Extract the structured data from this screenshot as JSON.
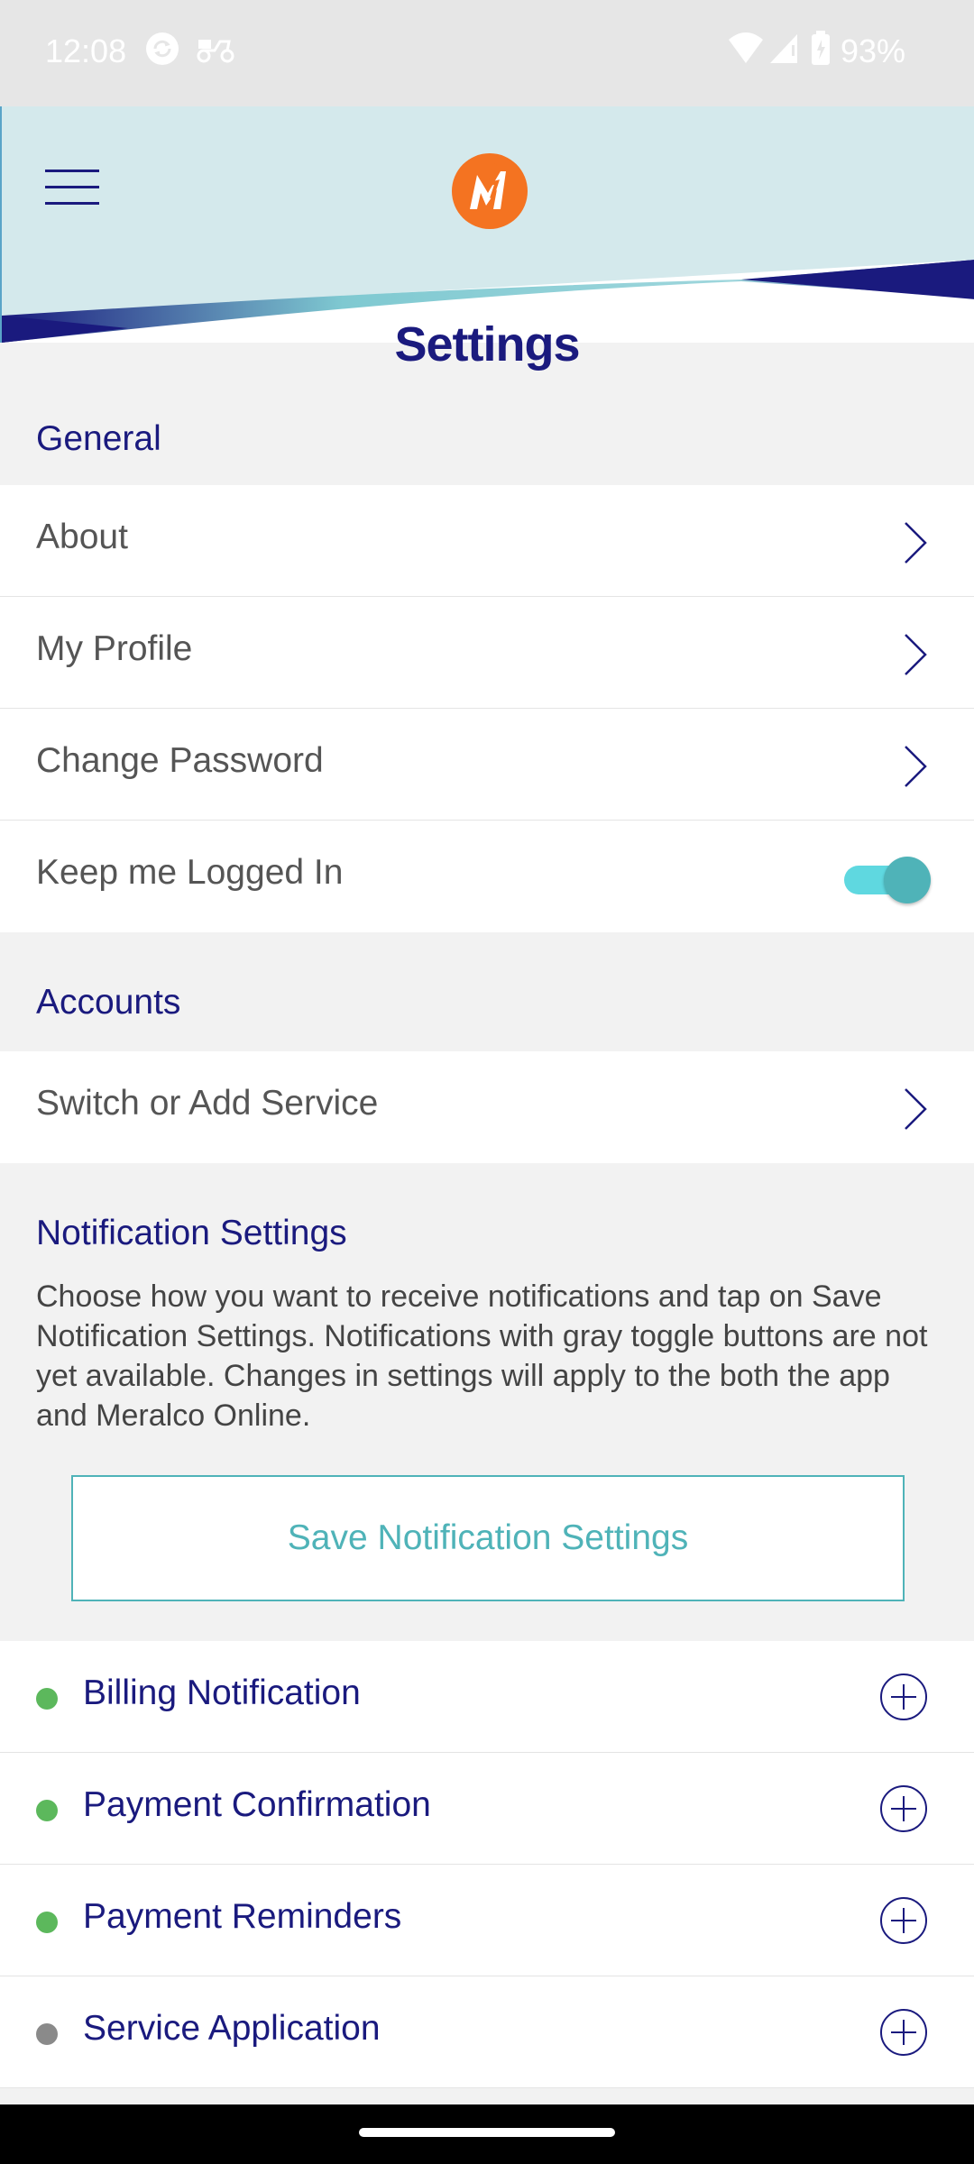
{
  "status_bar": {
    "time": "12:08",
    "battery": "93%",
    "icons": [
      "sync-icon",
      "delivery-scooter-icon",
      "wifi-icon",
      "signal-icon",
      "battery-icon"
    ]
  },
  "header": {
    "menu_icon": "hamburger-menu-icon",
    "logo": "meralco-logo",
    "page_title": "Settings",
    "colors": {
      "brand_navy": "#1a1a7e",
      "brand_orange": "#f47321",
      "teal": "#4fb3b8",
      "header_bg": "#d4e9ec"
    }
  },
  "general": {
    "heading": "General",
    "items": [
      {
        "label": "About"
      },
      {
        "label": "My Profile"
      },
      {
        "label": "Change Password"
      }
    ],
    "keep_logged_in": {
      "label": "Keep me Logged In",
      "enabled": true
    }
  },
  "accounts": {
    "heading": "Accounts",
    "items": [
      {
        "label": "Switch or Add Service"
      }
    ]
  },
  "notifications": {
    "heading": "Notification Settings",
    "description": "Choose how you want to receive notifications and tap on Save Notification Settings. Notifications with gray toggle buttons are not yet available. Changes in settings will apply to the both the app and Meralco Online.",
    "save_label": "Save Notification Settings",
    "items": [
      {
        "label": "Billing Notification",
        "status_color": "#5cb85c"
      },
      {
        "label": "Payment Confirmation",
        "status_color": "#5cb85c"
      },
      {
        "label": "Payment Reminders",
        "status_color": "#5cb85c"
      },
      {
        "label": "Service Application",
        "status_color": "#8a8a8a"
      }
    ]
  }
}
